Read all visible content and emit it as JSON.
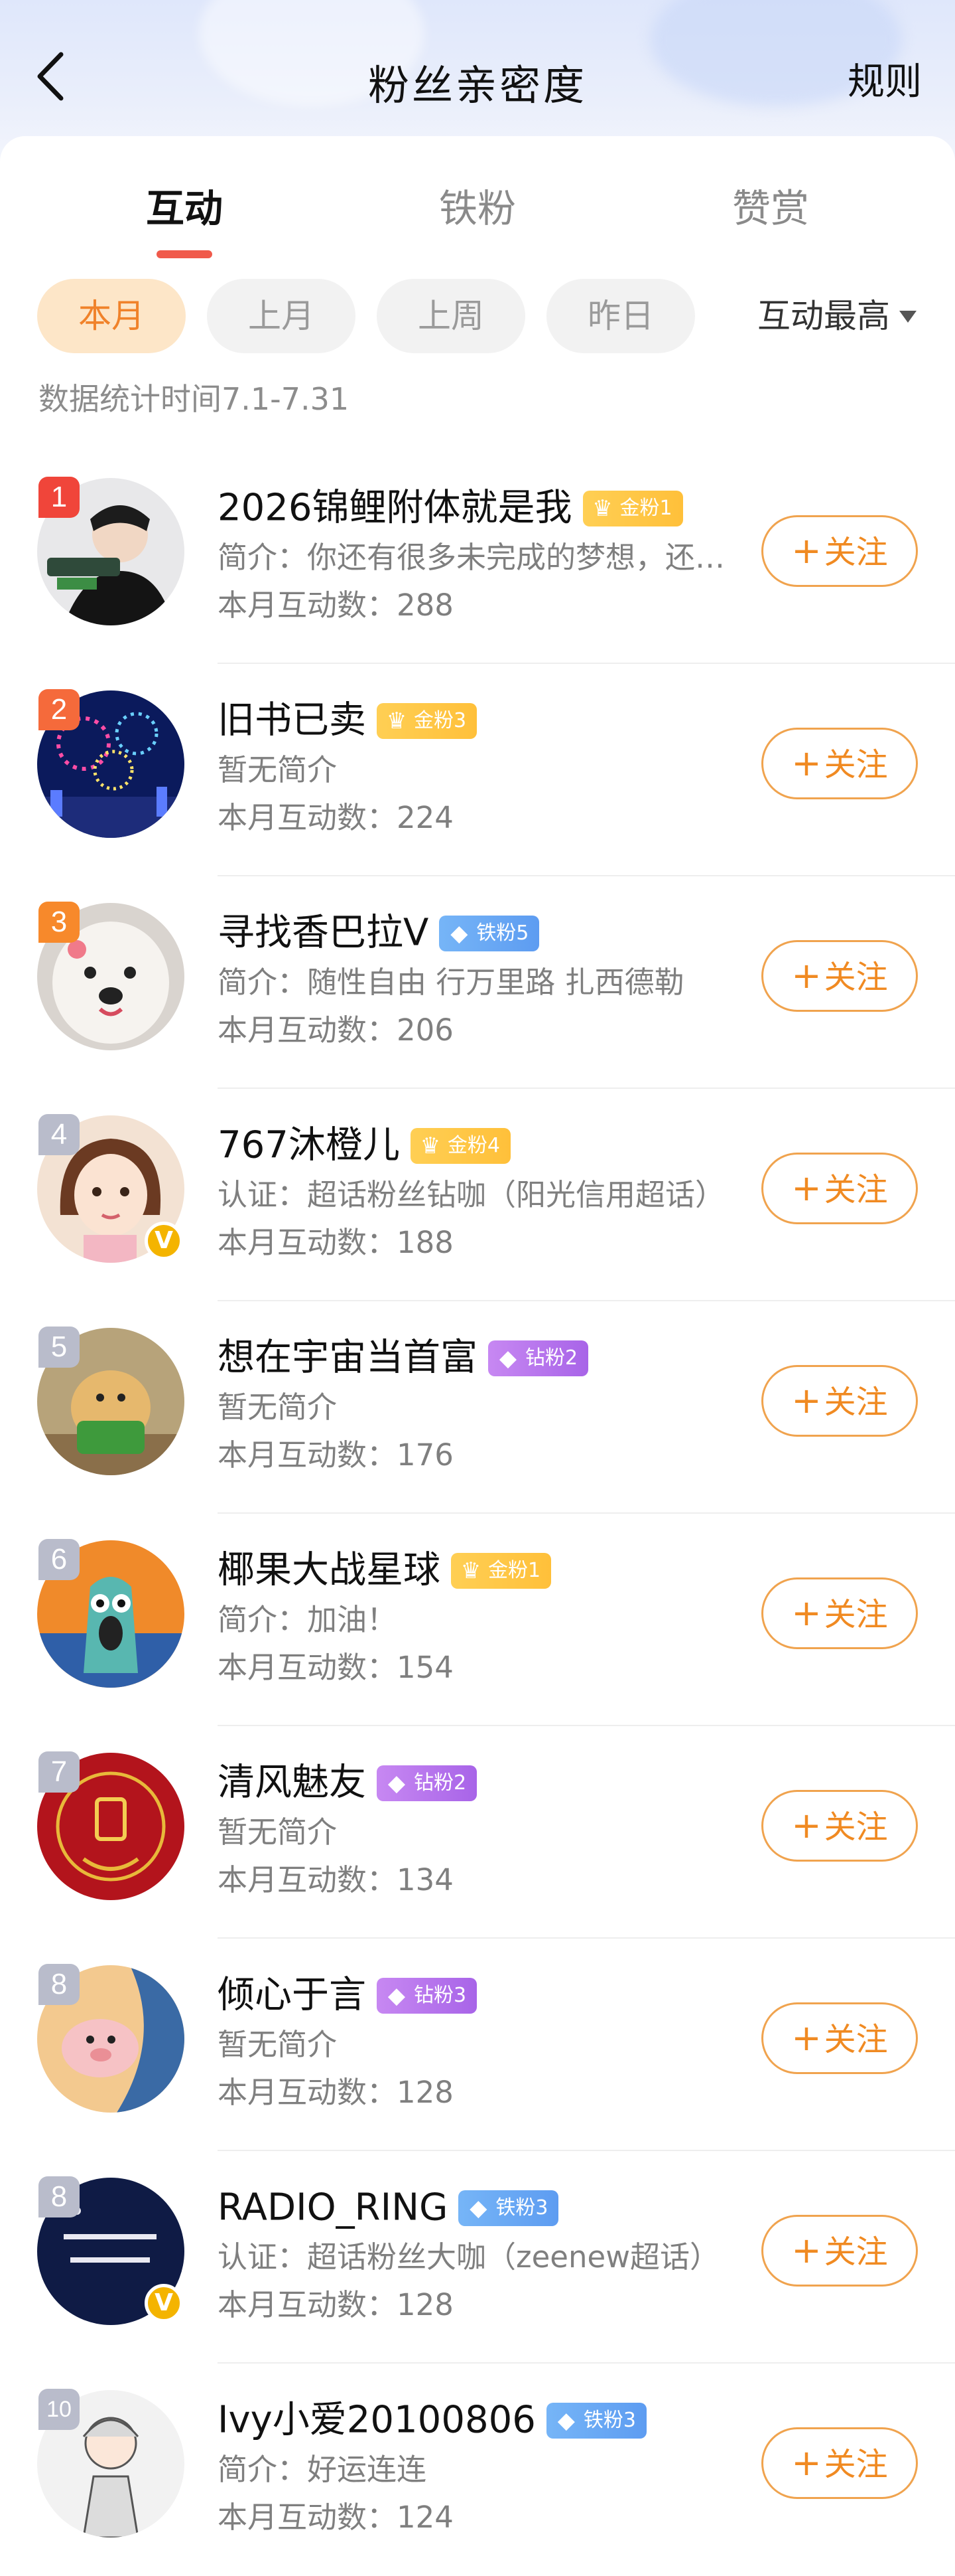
{
  "header": {
    "title": "粉丝亲密度",
    "rules_label": "规则"
  },
  "tabs": [
    {
      "label": "互动",
      "active": true
    },
    {
      "label": "铁粉",
      "active": false
    },
    {
      "label": "赞赏",
      "active": false
    }
  ],
  "period_filters": [
    {
      "label": "本月",
      "active": true
    },
    {
      "label": "上月",
      "active": false
    },
    {
      "label": "上周",
      "active": false
    },
    {
      "label": "昨日",
      "active": false
    }
  ],
  "sort": {
    "label": "互动最高"
  },
  "stat_time": "数据统计时间7.1-7.31",
  "follow_label": "关注",
  "colors": {
    "accent": "#f0822a",
    "tab_underline": "#f05a4b",
    "rank_1": "#f0453a",
    "rank_2": "#f56a3b",
    "rank_3": "#f7892b",
    "rank_other": "#b9bccb"
  },
  "fans": [
    {
      "rank": "1",
      "name": "2026锦鲤附体就是我",
      "badge": {
        "text": "金粉1",
        "type": "gold",
        "icon": "crown-icon"
      },
      "desc": "简介：你还有很多未完成的梦想，还有很多未实现的愿望",
      "count": "本月互动数：288",
      "verified": false
    },
    {
      "rank": "2",
      "name": "旧书已卖",
      "badge": {
        "text": "金粉3",
        "type": "gold",
        "icon": "crown-icon"
      },
      "desc": "暂无简介",
      "count": "本月互动数：224",
      "verified": false
    },
    {
      "rank": "3",
      "name": "寻找香巴拉V",
      "badge": {
        "text": "铁粉5",
        "type": "iron",
        "icon": "diamond-icon"
      },
      "desc": "简介：随性自由 行万里路 扎西德勒",
      "count": "本月互动数：206",
      "verified": false
    },
    {
      "rank": "4",
      "name": "767沐橙儿",
      "badge": {
        "text": "金粉4",
        "type": "gold",
        "icon": "crown-icon"
      },
      "desc": "认证：超话粉丝钻咖（阳光信用超话）",
      "count": "本月互动数：188",
      "verified": true
    },
    {
      "rank": "5",
      "name": "想在宇宙当首富",
      "badge": {
        "text": "钻粉2",
        "type": "diamond",
        "icon": "gem-icon"
      },
      "desc": "暂无简介",
      "count": "本月互动数：176",
      "verified": false
    },
    {
      "rank": "6",
      "name": "椰果大战星球",
      "badge": {
        "text": "金粉1",
        "type": "gold",
        "icon": "crown-icon"
      },
      "desc": "简介：加油！",
      "count": "本月互动数：154",
      "verified": false
    },
    {
      "rank": "7",
      "name": "清风魅友",
      "badge": {
        "text": "钻粉2",
        "type": "diamond",
        "icon": "gem-icon"
      },
      "desc": "暂无简介",
      "count": "本月互动数：134",
      "verified": false
    },
    {
      "rank": "8",
      "name": "倾心于言",
      "badge": {
        "text": "钻粉3",
        "type": "diamond",
        "icon": "gem-icon"
      },
      "desc": "暂无简介",
      "count": "本月互动数：128",
      "verified": false
    },
    {
      "rank": "8",
      "name": "RADIO_RING",
      "badge": {
        "text": "铁粉3",
        "type": "iron",
        "icon": "diamond-icon"
      },
      "desc": "认证：超话粉丝大咖（zeenew超话）",
      "count": "本月互动数：128",
      "verified": true
    },
    {
      "rank": "10",
      "name": "Ivy小爱20100806",
      "badge": {
        "text": "铁粉3",
        "type": "iron",
        "icon": "diamond-icon"
      },
      "desc": "简介：好运连连",
      "count": "本月互动数：124",
      "verified": false
    }
  ]
}
